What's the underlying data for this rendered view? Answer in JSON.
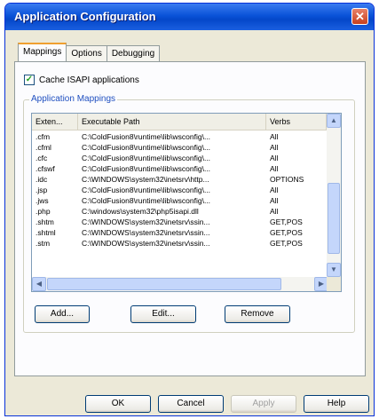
{
  "window": {
    "title": "Application Configuration",
    "close_glyph": "✕"
  },
  "tabs": [
    {
      "label": "Mappings"
    },
    {
      "label": "Options"
    },
    {
      "label": "Debugging"
    }
  ],
  "cache_checkbox": {
    "label": "Cache ISAPI applications",
    "checked": true,
    "glyph": "✓"
  },
  "group": {
    "label": "Application Mappings"
  },
  "table": {
    "headers": [
      "Exten...",
      "Executable Path",
      "Verbs"
    ],
    "rows": [
      [
        ".cfm",
        "C:\\ColdFusion8\\runtime\\lib\\wsconfig\\...",
        "All"
      ],
      [
        ".cfml",
        "C:\\ColdFusion8\\runtime\\lib\\wsconfig\\...",
        "All"
      ],
      [
        ".cfc",
        "C:\\ColdFusion8\\runtime\\lib\\wsconfig\\...",
        "All"
      ],
      [
        ".cfswf",
        "C:\\ColdFusion8\\runtime\\lib\\wsconfig\\...",
        "All"
      ],
      [
        ".idc",
        "C:\\WINDOWS\\system32\\inetsrv\\http...",
        "OPTIONS"
      ],
      [
        ".jsp",
        "C:\\ColdFusion8\\runtime\\lib\\wsconfig\\...",
        "All"
      ],
      [
        ".jws",
        "C:\\ColdFusion8\\runtime\\lib\\wsconfig\\...",
        "All"
      ],
      [
        ".php",
        "C:\\windows\\system32\\php5isapi.dll",
        "All"
      ],
      [
        ".shtm",
        "C:\\WINDOWS\\system32\\inetsrv\\ssin...",
        "GET,POS"
      ],
      [
        ".shtml",
        "C:\\WINDOWS\\system32\\inetsrv\\ssin...",
        "GET,POS"
      ],
      [
        ".stm",
        "C:\\WINDOWS\\system32\\inetsrv\\ssin...",
        "GET,POS"
      ]
    ]
  },
  "scrollbar": {
    "up": "▲",
    "down": "▼",
    "left": "◀",
    "right": "▶"
  },
  "buttons": {
    "add": "Add...",
    "edit": "Edit...",
    "remove": "Remove",
    "ok": "OK",
    "cancel": "Cancel",
    "apply": "Apply",
    "help": "Help"
  }
}
